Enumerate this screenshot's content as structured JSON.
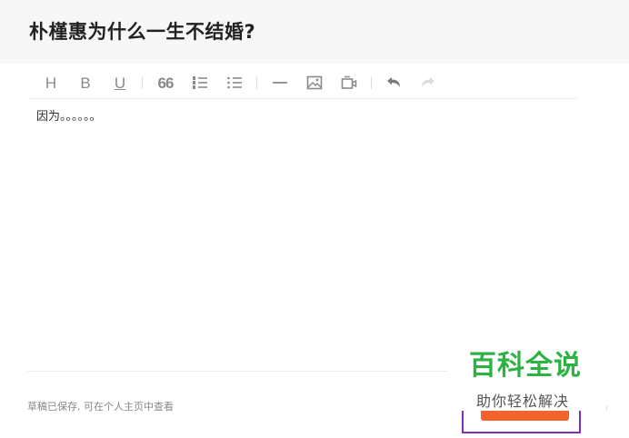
{
  "question": {
    "title": "朴槿惠为什么一生不结婚?"
  },
  "toolbar": {
    "heading_label": "H",
    "bold_label": "B",
    "underline_label": "U",
    "quote_label": "66"
  },
  "editor": {
    "content": "因为。。。。。。"
  },
  "footer": {
    "draft_status": "草稿已保存, 可在个人主页中查看"
  },
  "watermark": {
    "title": "百科全说",
    "subtitle": "助你轻松解决"
  },
  "colors": {
    "accent": "#f2642c",
    "frame": "#7b2fbf",
    "watermark": "#2eb244"
  }
}
